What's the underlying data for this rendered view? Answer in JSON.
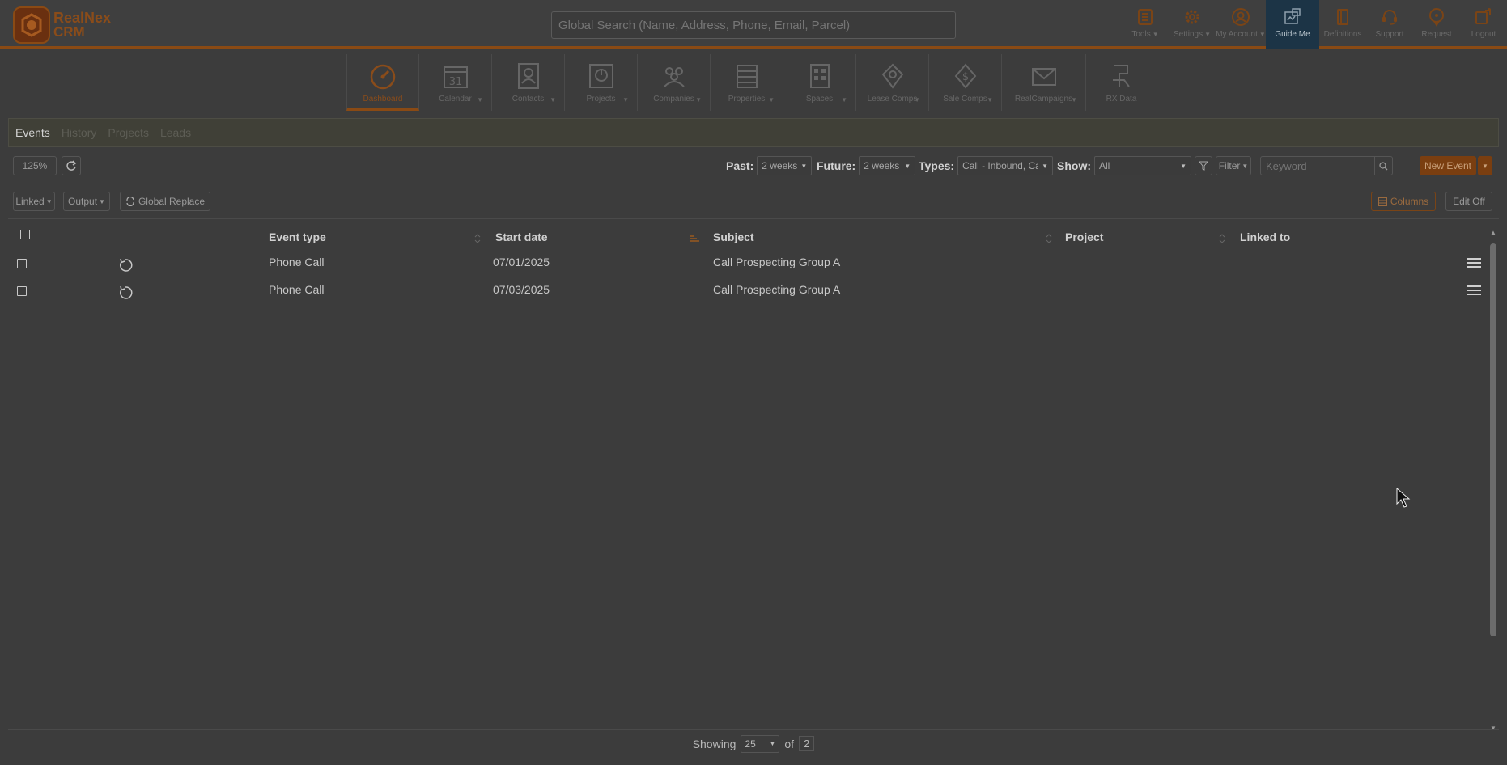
{
  "app": {
    "logo_line1": "RealNex",
    "logo_line2": "CRM"
  },
  "search": {
    "placeholder": "Global Search (Name, Address, Phone, Email, Parcel)"
  },
  "top_icons": [
    {
      "label": "Tools",
      "icon": "tools-icon",
      "caret": true
    },
    {
      "label": "Settings",
      "icon": "settings-icon",
      "caret": true
    },
    {
      "label": "My Account",
      "icon": "account-icon",
      "caret": true
    },
    {
      "label": "Guide Me",
      "icon": "guide-me-icon",
      "caret": false,
      "selected": true
    },
    {
      "label": "Definitions",
      "icon": "definitions-icon",
      "caret": false
    },
    {
      "label": "Support",
      "icon": "support-icon",
      "caret": false
    },
    {
      "label": "Request",
      "icon": "request-icon",
      "caret": false
    },
    {
      "label": "Logout",
      "icon": "logout-icon",
      "caret": false
    }
  ],
  "modules": [
    {
      "label": "Dashboard",
      "icon": "dashboard-icon",
      "active": true
    },
    {
      "label": "Calendar",
      "icon": "calendar-icon",
      "calendar_day": "31"
    },
    {
      "label": "Contacts",
      "icon": "contacts-icon"
    },
    {
      "label": "Projects",
      "icon": "projects-icon"
    },
    {
      "label": "Companies",
      "icon": "companies-icon"
    },
    {
      "label": "Properties",
      "icon": "properties-icon"
    },
    {
      "label": "Spaces",
      "icon": "spaces-icon"
    },
    {
      "label": "Lease Comps",
      "icon": "lease-comps-icon"
    },
    {
      "label": "Sale Comps",
      "icon": "sale-comps-icon",
      "symbol": "$"
    },
    {
      "label": "RealCampaigns",
      "icon": "realcampaigns-icon"
    },
    {
      "label": "RX Data",
      "icon": "rx-data-icon"
    }
  ],
  "subtabs": [
    "Events",
    "History",
    "Projects",
    "Leads"
  ],
  "toolbar": {
    "zoom": "125%",
    "past_label": "Past:",
    "past_value": "2 weeks",
    "future_label": "Future:",
    "future_value": "2 weeks",
    "types_label": "Types:",
    "types_value": "Call - Inbound, Ca",
    "show_label": "Show:",
    "show_value": "All",
    "filter_label": "Filter",
    "keyword_placeholder": "Keyword",
    "new_event_label": "New Event"
  },
  "toolbar2": {
    "linked_label": "Linked",
    "output_label": "Output",
    "global_replace_label": "Global Replace",
    "columns_label": "Columns",
    "edit_off_label": "Edit Off"
  },
  "table": {
    "columns": [
      "Event type",
      "Start date",
      "Subject",
      "Project",
      "Linked to"
    ],
    "rows": [
      {
        "event_type": "Phone Call",
        "start_date": "07/01/2025",
        "subject": "Call Prospecting Group A",
        "project": "",
        "linked_to": ""
      },
      {
        "event_type": "Phone Call",
        "start_date": "07/03/2025",
        "subject": "Call Prospecting Group A",
        "project": "",
        "linked_to": ""
      }
    ]
  },
  "footer": {
    "showing_label": "Showing",
    "per_page": "25",
    "of_label": "of",
    "total": "2"
  },
  "colors": {
    "brand": "#8a4a14",
    "guide_me_bg": "#1c3446",
    "overlay_bg": "#3c3c3c"
  }
}
